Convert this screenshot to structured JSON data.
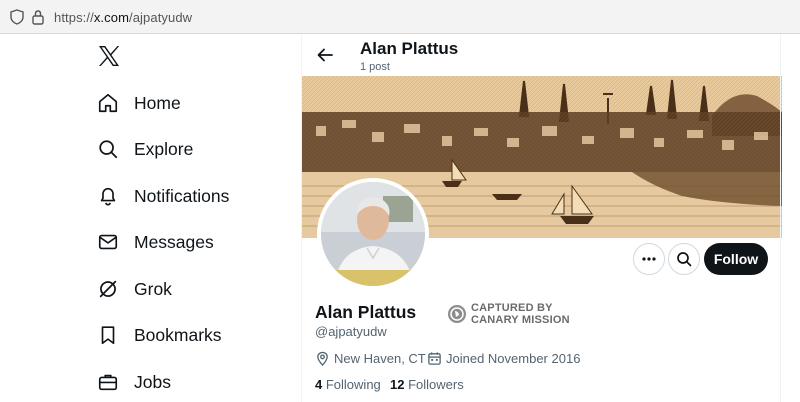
{
  "browser": {
    "url_prefix": "https://",
    "url_domain": "x.com",
    "url_path": "/ajpatyudw"
  },
  "nav": {
    "items": [
      {
        "label": "Home",
        "icon": "home-icon"
      },
      {
        "label": "Explore",
        "icon": "search-icon"
      },
      {
        "label": "Notifications",
        "icon": "bell-icon"
      },
      {
        "label": "Messages",
        "icon": "mail-icon"
      },
      {
        "label": "Grok",
        "icon": "grok-icon"
      },
      {
        "label": "Bookmarks",
        "icon": "bookmark-icon"
      },
      {
        "label": "Jobs",
        "icon": "briefcase-icon"
      }
    ]
  },
  "header": {
    "name": "Alan Plattus",
    "post_count": "1 post"
  },
  "actions": {
    "follow_label": "Follow"
  },
  "profile": {
    "name": "Alan Plattus",
    "handle": "@ajpatyudw",
    "badge_line1": "CAPTURED BY",
    "badge_line2": "CANARY MISSION",
    "location": "New Haven, CT",
    "joined": "Joined November 2016",
    "following_count": "4",
    "following_label": "Following",
    "followers_count": "12",
    "followers_label": "Followers"
  },
  "colors": {
    "text_primary": "#0f1419",
    "text_secondary": "#536471",
    "follow_button_bg": "#0f1419",
    "banner_base": "#e6c79a"
  }
}
